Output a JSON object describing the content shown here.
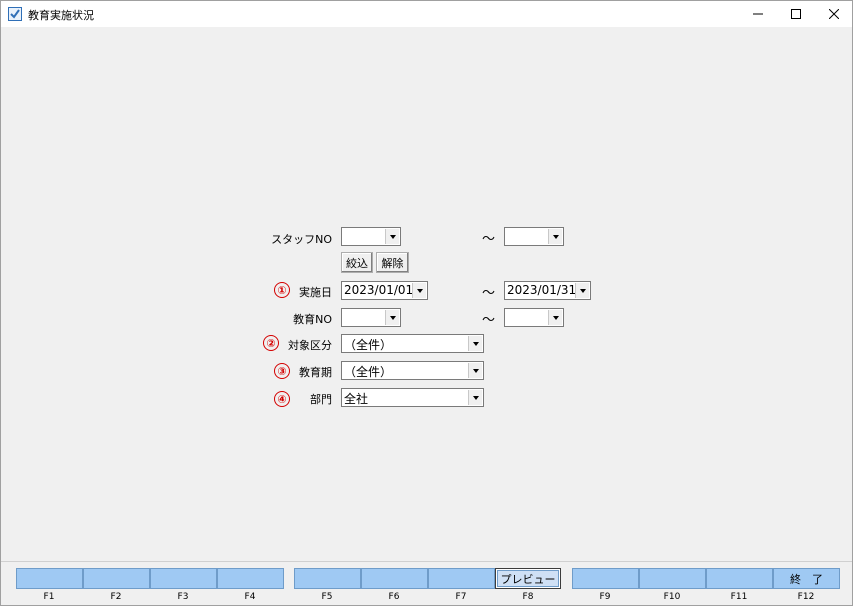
{
  "window": {
    "title": "教育実施状況",
    "app_icon": "app-check-icon",
    "controls": [
      "minimize-icon",
      "maximize-icon",
      "close-icon"
    ]
  },
  "form": {
    "staff_no": {
      "label": "スタッフNO",
      "from": "",
      "to": "",
      "separator": "～"
    },
    "filter_buttons": {
      "apply": "絞込",
      "clear": "解除"
    },
    "date": {
      "marker": "①",
      "label": "実施日",
      "from": "2023/01/01",
      "to": "2023/01/31",
      "separator": "～"
    },
    "education_no": {
      "label": "教育NO",
      "from": "",
      "to": "",
      "separator": "～"
    },
    "target_category": {
      "marker": "②",
      "label": "対象区分",
      "value": "（全件）"
    },
    "education_period": {
      "marker": "③",
      "label": "教育期",
      "value": "（全件）"
    },
    "department": {
      "marker": "④",
      "label": "部門",
      "value": "全社"
    }
  },
  "function_keys": [
    {
      "key": "F1",
      "label": ""
    },
    {
      "key": "F2",
      "label": ""
    },
    {
      "key": "F3",
      "label": ""
    },
    {
      "key": "F4",
      "label": ""
    },
    {
      "key": "F5",
      "label": ""
    },
    {
      "key": "F6",
      "label": ""
    },
    {
      "key": "F7",
      "label": ""
    },
    {
      "key": "F8",
      "label": "プレビュー"
    },
    {
      "key": "F9",
      "label": ""
    },
    {
      "key": "F10",
      "label": ""
    },
    {
      "key": "F11",
      "label": ""
    },
    {
      "key": "F12",
      "label": "終　了"
    }
  ],
  "colors": {
    "function_key": "#9fc9f3",
    "marker": "#d40000",
    "background": "#f0f0f0"
  }
}
